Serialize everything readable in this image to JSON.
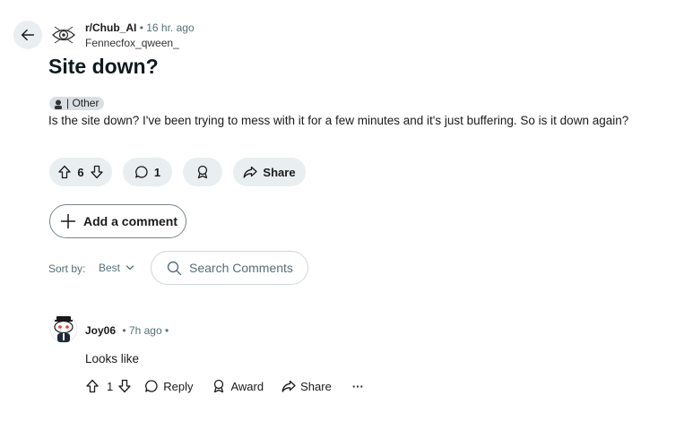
{
  "post": {
    "subreddit": "r/Chub_AI",
    "separator": "•",
    "time": "16 hr. ago",
    "author": "Fennecfox_qween_",
    "title": "Site down?",
    "flair": "| Other",
    "body": "Is the site down? I've been trying to mess with it for a few minutes and it's just buffering. So is it down again?",
    "upvotes": "6",
    "comments": "1",
    "share_label": "Share"
  },
  "add_comment_label": "Add a comment",
  "sort": {
    "label": "Sort by:",
    "value": "Best"
  },
  "search": {
    "placeholder": "Search Comments"
  },
  "comment": {
    "author": "Joy06",
    "meta": "• 7h ago •",
    "text": "Looks like",
    "votes": "1",
    "reply_label": "Reply",
    "award_label": "Award",
    "share_label": "Share",
    "more_label": "···"
  },
  "icons": [
    "back-arrow-icon",
    "subreddit-eye-icon",
    "upvote-icon",
    "downvote-icon",
    "comment-icon",
    "award-icon",
    "share-icon",
    "plus-icon",
    "chevron-down-icon",
    "search-icon",
    "snoo-avatar-icon"
  ]
}
